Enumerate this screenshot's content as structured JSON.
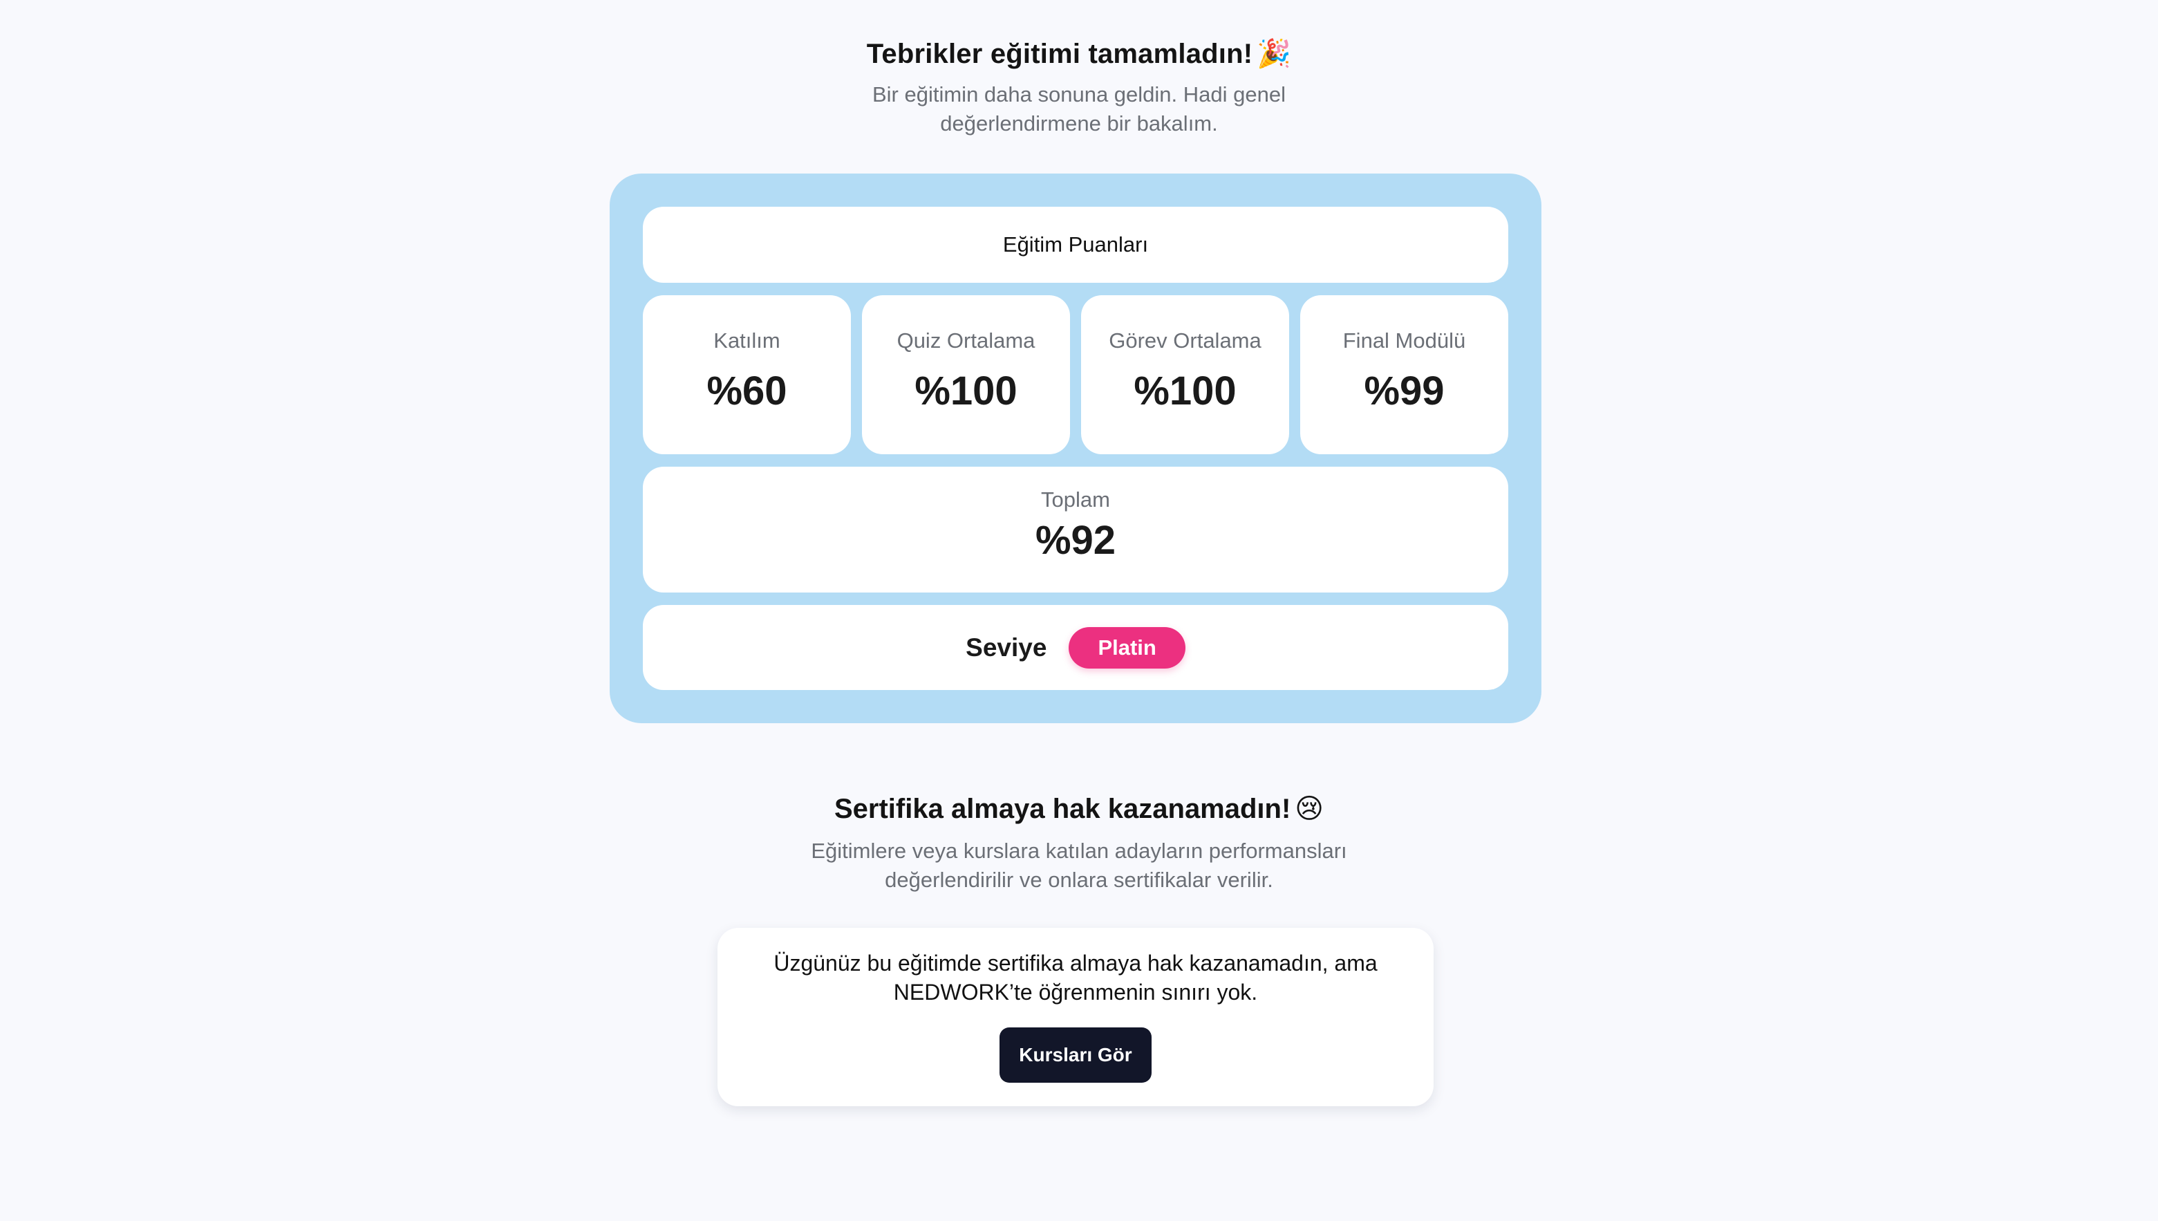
{
  "header": {
    "title": "Tebrikler eğitimi tamamladın!",
    "title_emoji": "🎉",
    "subtitle": "Bir eğitimin daha sonuna geldin. Hadi genel değerlendirmene bir bakalım."
  },
  "scores": {
    "heading": "Eğitim Puanları",
    "metrics": [
      {
        "label": "Katılım",
        "value": "%60"
      },
      {
        "label": "Quiz Ortalama",
        "value": "%100"
      },
      {
        "label": "Görev Ortalama",
        "value": "%100"
      },
      {
        "label": "Final Modülü",
        "value": "%99"
      }
    ],
    "total": {
      "label": "Toplam",
      "value": "%92"
    },
    "level": {
      "label": "Seviye",
      "badge": "Platin"
    }
  },
  "certificate": {
    "title": "Sertifika almaya hak kazanamadın!",
    "title_emoji": "😢",
    "description": "Eğitimlere veya kurslara katılan adayların performansları değerlendirilir ve onlara sertifikalar verilir.",
    "notice": "Üzgünüz bu eğitimde sertifika almaya hak kazanamadın, ama NEDWORK’te öğrenmenin sınırı yok.",
    "button_label": "Kursları Gör"
  },
  "colors": {
    "page_background": "#f8f9fd",
    "panel_background": "#b3dcf5",
    "badge_background": "#ec3080",
    "button_background": "#121629"
  }
}
